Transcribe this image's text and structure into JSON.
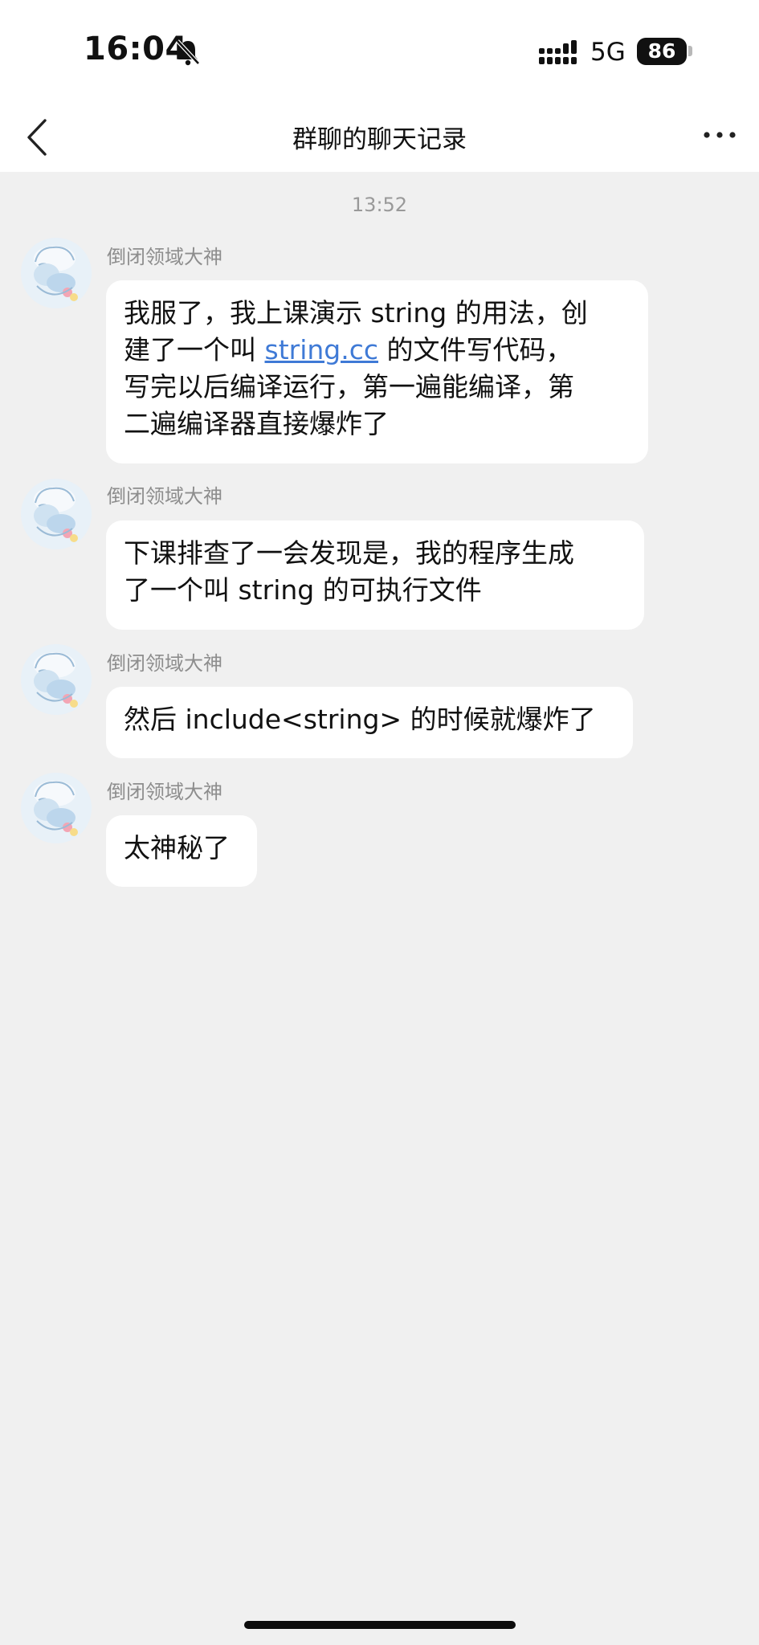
{
  "status_bar": {
    "time": "16:04",
    "network": "5G",
    "battery": "86",
    "bell_icon": "bell-muted-icon",
    "signal_icon": "cellular-signal-icon"
  },
  "nav": {
    "title": "群聊的聊天记录",
    "back_icon": "chevron-left-icon",
    "more_icon": "more-dots-icon"
  },
  "chat": {
    "timestamp": "13:52",
    "messages": [
      {
        "sender": "倒闭领域大神",
        "line1": "我服了，我上课演示 string 的用法，创",
        "line2_prefix": "建了一个叫 ",
        "line2_link": "string.cc",
        "line2_suffix": " 的文件写代码，",
        "line3": "写完以后编译运行，第一遍能编译，第",
        "line4": "二遍编译器直接爆炸了"
      },
      {
        "sender": "倒闭领域大神",
        "line1": "下课排查了一会发现是，我的程序生成",
        "line2": "了一个叫 string 的可执行文件"
      },
      {
        "sender": "倒闭领域大神",
        "line1": "然后 include<string> 的时候就爆炸了"
      },
      {
        "sender": "倒闭领域大神",
        "line1": "太神秘了"
      }
    ]
  },
  "colors": {
    "background": "#f0f0f0",
    "bubble": "#ffffff",
    "link": "#3f7ad6",
    "muted_text": "#8d8d8d"
  }
}
